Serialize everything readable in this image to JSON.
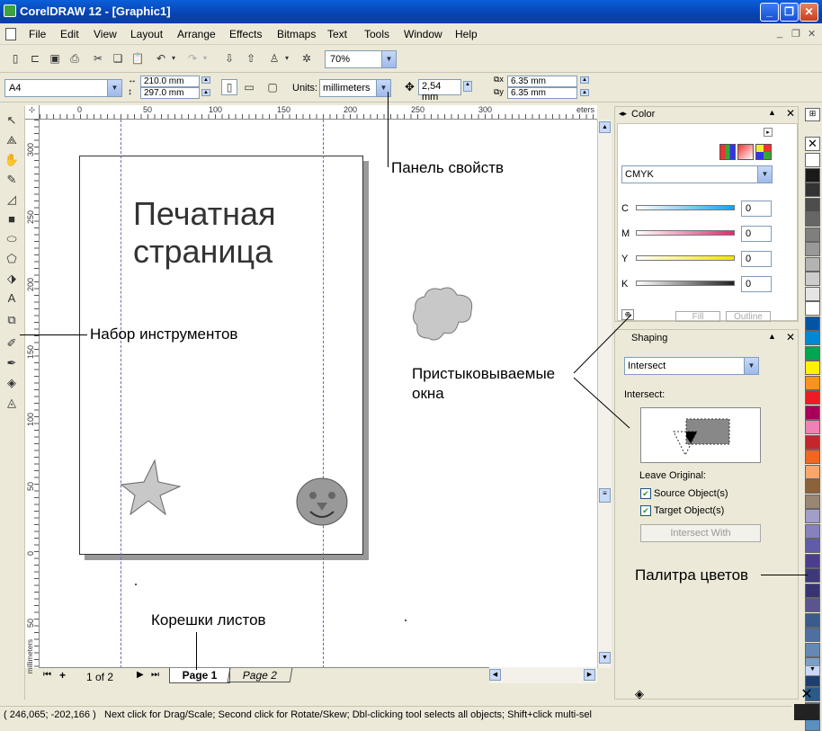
{
  "window": {
    "title": "CorelDRAW 12 - [Graphic1]"
  },
  "menu": [
    "File",
    "Edit",
    "View",
    "Layout",
    "Arrange",
    "Effects",
    "Bitmaps",
    "Text",
    "Tools",
    "Window",
    "Help"
  ],
  "toolbar": {
    "zoom": "70%"
  },
  "property_bar": {
    "paper_size": "A4",
    "width": "210.0 mm",
    "height": "297.0 mm",
    "units_label": "Units:",
    "units": "millimeters",
    "nudge": "2,54 mm",
    "dup_x": "6.35 mm",
    "dup_y": "6.35 mm"
  },
  "rulers": {
    "h_ticks": [
      "0",
      "50",
      "100",
      "150",
      "200",
      "250",
      "300"
    ],
    "h_unit": "eters",
    "v_ticks": [
      "300",
      "250",
      "200",
      "150",
      "100",
      "50",
      "0",
      "50"
    ],
    "v_unit": "millimeters"
  },
  "page_text": {
    "line1": "Печатная",
    "line2": "страница"
  },
  "callouts": {
    "property_bar": "Панель свойств",
    "toolbox": "Набор инструментов",
    "dockers_1": "Пристыковываемые",
    "dockers_2": "окна",
    "palette": "Палитра цветов",
    "page_tabs": "Корешки листов"
  },
  "page_tabs": {
    "counter": "1 of 2",
    "tabs": [
      "Page 1",
      "Page 2"
    ]
  },
  "color_docker": {
    "title": "Color",
    "model": "CMYK",
    "channels": [
      {
        "label": "C",
        "value": "0",
        "color": "#1aa0e8"
      },
      {
        "label": "M",
        "value": "0",
        "color": "#e02a70"
      },
      {
        "label": "Y",
        "value": "0",
        "color": "#f2e500"
      },
      {
        "label": "K",
        "value": "0",
        "color": "#222222"
      }
    ],
    "fill_button": "Fill",
    "outline_button": "Outline"
  },
  "shaping_docker": {
    "title": "Shaping",
    "mode": "Intersect",
    "section_label": "Intersect:",
    "leave_original": "Leave Original:",
    "source_label": "Source Object(s)",
    "target_label": "Target Object(s)",
    "source_checked": true,
    "target_checked": true,
    "action_button": "Intersect With"
  },
  "palette_colors": [
    "#ffffff",
    "#1a1a1a",
    "#333333",
    "#4d4d4d",
    "#666666",
    "#7f7f7f",
    "#999999",
    "#b3b3b3",
    "#cccccc",
    "#e5e5e5",
    "#ffffff",
    "#0055a5",
    "#0088d2",
    "#00a651",
    "#fff200",
    "#f7941d",
    "#ed1c24",
    "#a8005a",
    "#ee82b4",
    "#c1272d",
    "#f26522",
    "#f9a56b",
    "#8c6239",
    "#998675",
    "#a39dc9",
    "#8781bd",
    "#605ca8",
    "#4b3e8f",
    "#3e3a7a",
    "#383474",
    "#5a5590",
    "#3a5b8c",
    "#4e6fa0",
    "#6688b5",
    "#7aa0c8",
    "#1c3f6e",
    "#2a5a8a",
    "#3b73a7",
    "#5b8fc0"
  ],
  "status": {
    "coords": "( 246,065; -202,166 )",
    "message": "Next click for Drag/Scale; Second click for Rotate/Skew; Dbl-clicking tool selects all objects; Shift+click multi-selec"
  }
}
